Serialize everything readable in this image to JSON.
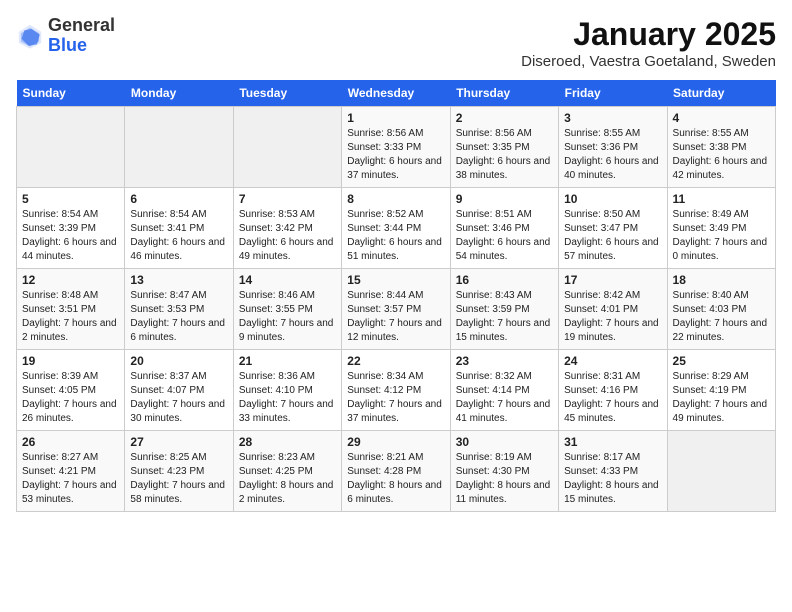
{
  "header": {
    "logo_general": "General",
    "logo_blue": "Blue",
    "month_title": "January 2025",
    "location": "Diseroed, Vaestra Goetaland, Sweden"
  },
  "days_of_week": [
    "Sunday",
    "Monday",
    "Tuesday",
    "Wednesday",
    "Thursday",
    "Friday",
    "Saturday"
  ],
  "weeks": [
    [
      {
        "day": "",
        "info": ""
      },
      {
        "day": "",
        "info": ""
      },
      {
        "day": "",
        "info": ""
      },
      {
        "day": "1",
        "info": "Sunrise: 8:56 AM\nSunset: 3:33 PM\nDaylight: 6 hours and 37 minutes."
      },
      {
        "day": "2",
        "info": "Sunrise: 8:56 AM\nSunset: 3:35 PM\nDaylight: 6 hours and 38 minutes."
      },
      {
        "day": "3",
        "info": "Sunrise: 8:55 AM\nSunset: 3:36 PM\nDaylight: 6 hours and 40 minutes."
      },
      {
        "day": "4",
        "info": "Sunrise: 8:55 AM\nSunset: 3:38 PM\nDaylight: 6 hours and 42 minutes."
      }
    ],
    [
      {
        "day": "5",
        "info": "Sunrise: 8:54 AM\nSunset: 3:39 PM\nDaylight: 6 hours and 44 minutes."
      },
      {
        "day": "6",
        "info": "Sunrise: 8:54 AM\nSunset: 3:41 PM\nDaylight: 6 hours and 46 minutes."
      },
      {
        "day": "7",
        "info": "Sunrise: 8:53 AM\nSunset: 3:42 PM\nDaylight: 6 hours and 49 minutes."
      },
      {
        "day": "8",
        "info": "Sunrise: 8:52 AM\nSunset: 3:44 PM\nDaylight: 6 hours and 51 minutes."
      },
      {
        "day": "9",
        "info": "Sunrise: 8:51 AM\nSunset: 3:46 PM\nDaylight: 6 hours and 54 minutes."
      },
      {
        "day": "10",
        "info": "Sunrise: 8:50 AM\nSunset: 3:47 PM\nDaylight: 6 hours and 57 minutes."
      },
      {
        "day": "11",
        "info": "Sunrise: 8:49 AM\nSunset: 3:49 PM\nDaylight: 7 hours and 0 minutes."
      }
    ],
    [
      {
        "day": "12",
        "info": "Sunrise: 8:48 AM\nSunset: 3:51 PM\nDaylight: 7 hours and 2 minutes."
      },
      {
        "day": "13",
        "info": "Sunrise: 8:47 AM\nSunset: 3:53 PM\nDaylight: 7 hours and 6 minutes."
      },
      {
        "day": "14",
        "info": "Sunrise: 8:46 AM\nSunset: 3:55 PM\nDaylight: 7 hours and 9 minutes."
      },
      {
        "day": "15",
        "info": "Sunrise: 8:44 AM\nSunset: 3:57 PM\nDaylight: 7 hours and 12 minutes."
      },
      {
        "day": "16",
        "info": "Sunrise: 8:43 AM\nSunset: 3:59 PM\nDaylight: 7 hours and 15 minutes."
      },
      {
        "day": "17",
        "info": "Sunrise: 8:42 AM\nSunset: 4:01 PM\nDaylight: 7 hours and 19 minutes."
      },
      {
        "day": "18",
        "info": "Sunrise: 8:40 AM\nSunset: 4:03 PM\nDaylight: 7 hours and 22 minutes."
      }
    ],
    [
      {
        "day": "19",
        "info": "Sunrise: 8:39 AM\nSunset: 4:05 PM\nDaylight: 7 hours and 26 minutes."
      },
      {
        "day": "20",
        "info": "Sunrise: 8:37 AM\nSunset: 4:07 PM\nDaylight: 7 hours and 30 minutes."
      },
      {
        "day": "21",
        "info": "Sunrise: 8:36 AM\nSunset: 4:10 PM\nDaylight: 7 hours and 33 minutes."
      },
      {
        "day": "22",
        "info": "Sunrise: 8:34 AM\nSunset: 4:12 PM\nDaylight: 7 hours and 37 minutes."
      },
      {
        "day": "23",
        "info": "Sunrise: 8:32 AM\nSunset: 4:14 PM\nDaylight: 7 hours and 41 minutes."
      },
      {
        "day": "24",
        "info": "Sunrise: 8:31 AM\nSunset: 4:16 PM\nDaylight: 7 hours and 45 minutes."
      },
      {
        "day": "25",
        "info": "Sunrise: 8:29 AM\nSunset: 4:19 PM\nDaylight: 7 hours and 49 minutes."
      }
    ],
    [
      {
        "day": "26",
        "info": "Sunrise: 8:27 AM\nSunset: 4:21 PM\nDaylight: 7 hours and 53 minutes."
      },
      {
        "day": "27",
        "info": "Sunrise: 8:25 AM\nSunset: 4:23 PM\nDaylight: 7 hours and 58 minutes."
      },
      {
        "day": "28",
        "info": "Sunrise: 8:23 AM\nSunset: 4:25 PM\nDaylight: 8 hours and 2 minutes."
      },
      {
        "day": "29",
        "info": "Sunrise: 8:21 AM\nSunset: 4:28 PM\nDaylight: 8 hours and 6 minutes."
      },
      {
        "day": "30",
        "info": "Sunrise: 8:19 AM\nSunset: 4:30 PM\nDaylight: 8 hours and 11 minutes."
      },
      {
        "day": "31",
        "info": "Sunrise: 8:17 AM\nSunset: 4:33 PM\nDaylight: 8 hours and 15 minutes."
      },
      {
        "day": "",
        "info": ""
      }
    ]
  ]
}
